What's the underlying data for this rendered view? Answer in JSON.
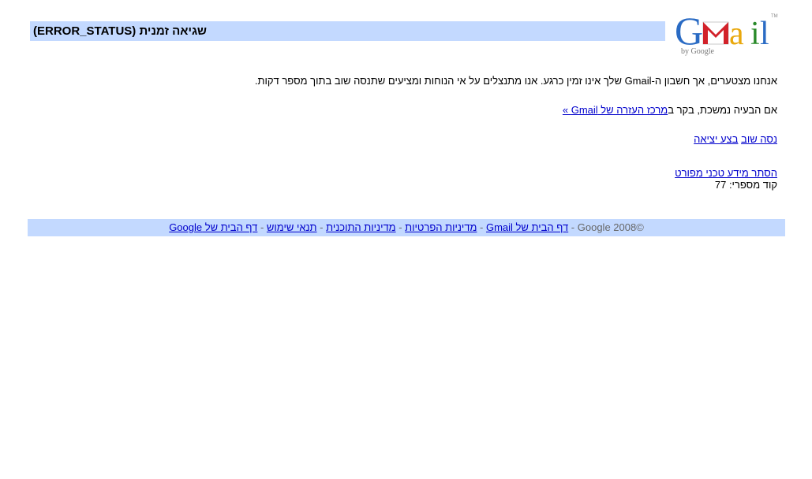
{
  "logo": {
    "main": "Gmail",
    "sub": "by Google",
    "tm": "TM"
  },
  "header": {
    "title": "שגיאה זמנית (ERROR_STATUS)"
  },
  "message": {
    "line1": "אנחנו מצטערים, אך חשבון ה-Gmail שלך אינו זמין כרגע. אנו מתנצלים על אי הנוחות ומציעים שתנסה שוב בתוך מספר דקות.",
    "line2_prefix": "אם הבעיה נמשכת, בקר ב",
    "help_link": "מרכז העזרה של Gmail »"
  },
  "actions": {
    "retry": "נסה שוב",
    "signout": "בצע יציאה"
  },
  "technical": {
    "hide_link": "הסתר מידע טכני מפורט",
    "code_label": "קוד מספרי:",
    "code_value": "77"
  },
  "footer": {
    "copyright": "©2008 Google",
    "sep": " - ",
    "links": [
      "דף הבית של Gmail",
      "מדיניות הפרטיות",
      "מדיניות התוכנית",
      "תנאי שימוש",
      "דף הבית של Google"
    ]
  },
  "colors": {
    "bar": "#c3d9ff",
    "link": "#0000cc"
  }
}
